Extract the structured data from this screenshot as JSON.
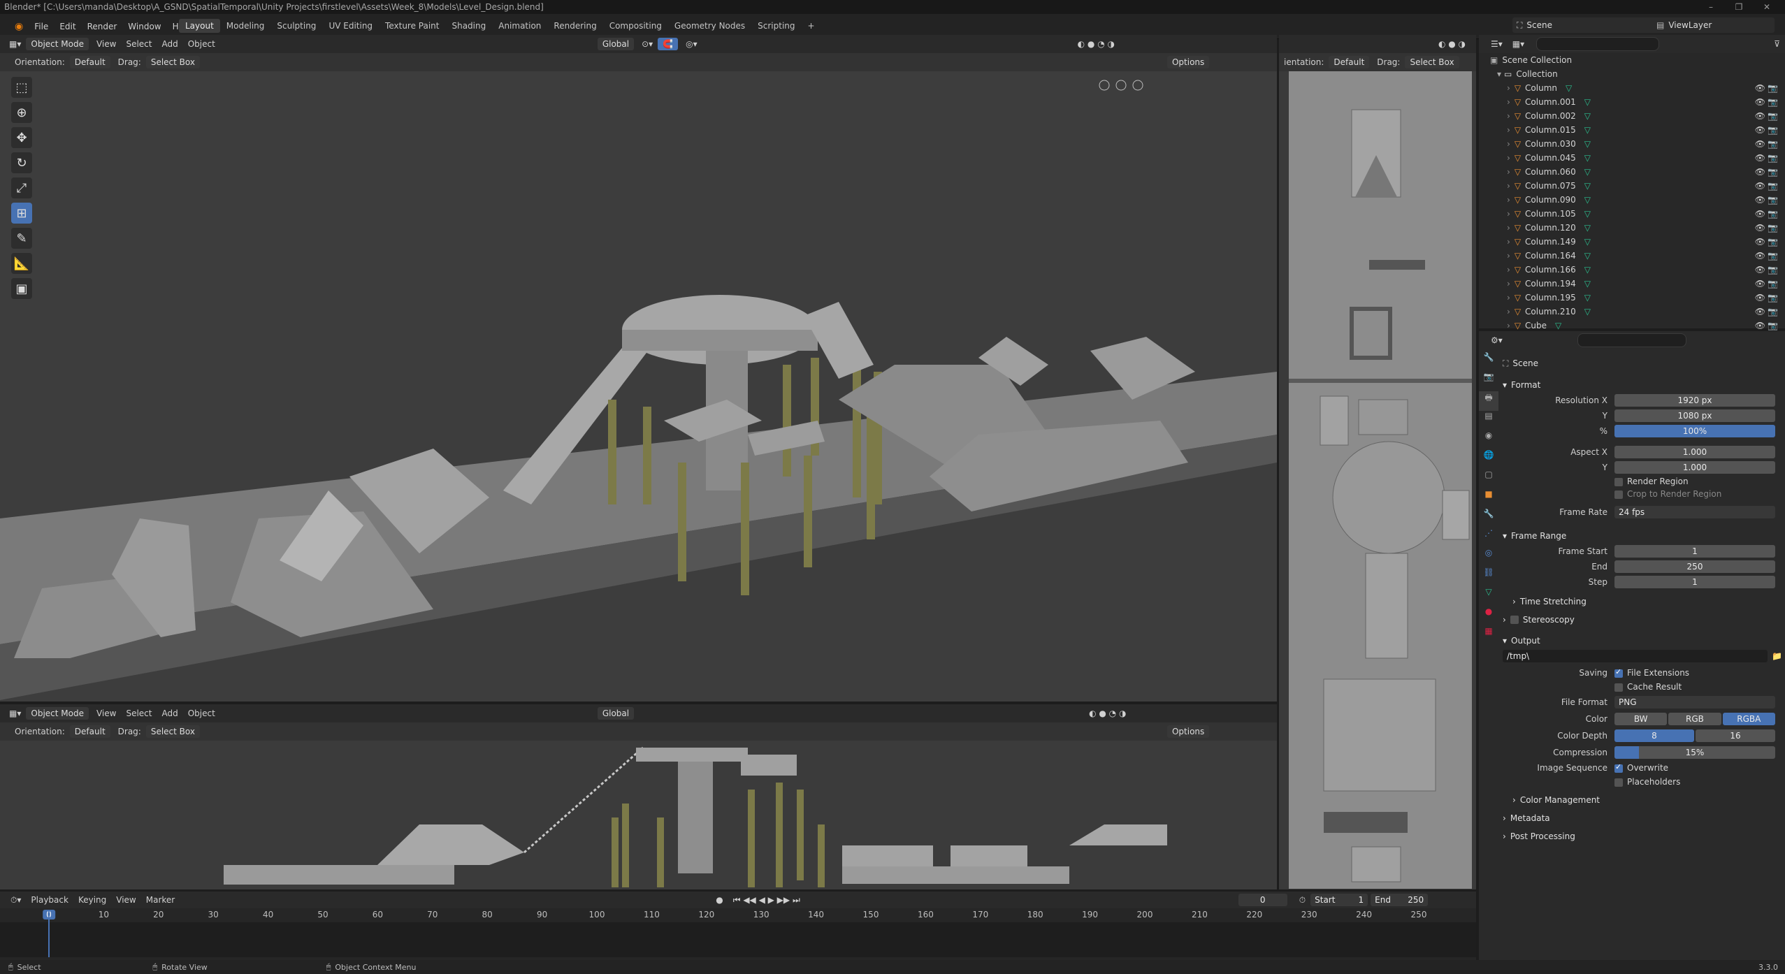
{
  "window": {
    "title": "Blender* [C:\\Users\\manda\\Desktop\\A_GSND\\SpatialTemporal\\Unity Projects\\firstlevel\\Assets\\Week_8\\Models\\Level_Design.blend]"
  },
  "menu": [
    "File",
    "Edit",
    "Render",
    "Window",
    "Help"
  ],
  "workspaces": [
    "Layout",
    "Modeling",
    "Sculpting",
    "UV Editing",
    "Texture Paint",
    "Shading",
    "Animation",
    "Rendering",
    "Compositing",
    "Geometry Nodes",
    "Scripting",
    "+"
  ],
  "active_workspace": "Layout",
  "scene": {
    "label": "Scene",
    "view_layer": "ViewLayer"
  },
  "viewport_header": {
    "mode": "Object Mode",
    "menus": [
      "View",
      "Select",
      "Add",
      "Object"
    ],
    "transform": "Global",
    "options": "Options",
    "orientation_label": "Orientation:",
    "orientation_value": "Default",
    "drag_label": "Drag:",
    "drag_value": "Select Box",
    "side_orientation_label": "ientation:"
  },
  "outliner": {
    "search_placeholder": "",
    "root": "Scene Collection",
    "collection": "Collection",
    "items": [
      "Column",
      "Column.001",
      "Column.002",
      "Column.015",
      "Column.030",
      "Column.045",
      "Column.060",
      "Column.075",
      "Column.090",
      "Column.105",
      "Column.120",
      "Column.149",
      "Column.164",
      "Column.166",
      "Column.194",
      "Column.195",
      "Column.210",
      "Cube"
    ]
  },
  "properties": {
    "context": "Scene",
    "format": {
      "title": "Format",
      "resolution_x_label": "Resolution X",
      "resolution_x": "1920 px",
      "y_label": "Y",
      "resolution_y": "1080 px",
      "percent_label": "%",
      "percent": "100%",
      "aspect_x_label": "Aspect X",
      "aspect_x": "1.000",
      "aspect_y_label": "Y",
      "aspect_y": "1.000",
      "render_region": "Render Region",
      "crop_region": "Crop to Render Region",
      "frame_rate_label": "Frame Rate",
      "frame_rate": "24 fps"
    },
    "frame_range": {
      "title": "Frame Range",
      "start_label": "Frame Start",
      "start": "1",
      "end_label": "End",
      "end": "250",
      "step_label": "Step",
      "step": "1",
      "time_stretching": "Time Stretching"
    },
    "stereoscopy": "Stereoscopy",
    "output": {
      "title": "Output",
      "path": "/tmp\\",
      "saving_label": "Saving",
      "file_extensions": "File Extensions",
      "cache_result": "Cache Result",
      "file_format_label": "File Format",
      "file_format": "PNG",
      "color_label": "Color",
      "color_options": [
        "BW",
        "RGB",
        "RGBA"
      ],
      "color_selected": "RGBA",
      "depth_label": "Color Depth",
      "depth_options": [
        "8",
        "16"
      ],
      "depth_selected": "8",
      "compression_label": "Compression",
      "compression": "15%",
      "compression_fraction": 0.15,
      "image_seq_label": "Image Sequence",
      "overwrite": "Overwrite",
      "placeholders": "Placeholders",
      "color_management": "Color Management"
    },
    "metadata": "Metadata",
    "post_processing": "Post Processing"
  },
  "timeline": {
    "menus": [
      "Playback",
      "Keying",
      "View",
      "Marker"
    ],
    "current_frame": "0",
    "start_label": "Start",
    "start": "1",
    "end_label": "End",
    "end": "250",
    "ticks": [
      "0",
      "10",
      "20",
      "30",
      "40",
      "50",
      "60",
      "70",
      "80",
      "90",
      "100",
      "110",
      "120",
      "130",
      "140",
      "150",
      "160",
      "170",
      "180",
      "190",
      "200",
      "210",
      "220",
      "230",
      "240",
      "250"
    ]
  },
  "status_bar": {
    "select": "Select",
    "rotate": "Rotate View",
    "context_menu": "Object Context Menu",
    "version": "3.3.0"
  }
}
